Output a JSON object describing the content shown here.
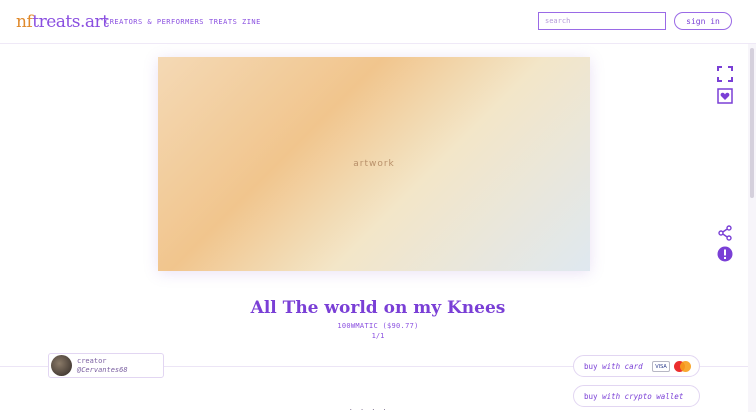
{
  "header": {
    "logo_nf": "nf",
    "logo_rest": "treats.art",
    "nav": [
      "CREATORS & PERFORMERS",
      "TREATS ZINE"
    ],
    "search_placeholder": "search",
    "signin_label": "sign in"
  },
  "artwork": {
    "title": "All The world on my Knees",
    "price": "100WMATIC ($90.77)",
    "edition": "1/1",
    "placeholder_label": "artwork"
  },
  "creator": {
    "label": "creator",
    "handle": "@Cervantes68"
  },
  "purchase": {
    "card_prefix": "buy",
    "card_suffix": "with card",
    "card_brand": "VISA",
    "wallet_prefix": "buy",
    "wallet_suffix": "with crypto wallet"
  },
  "icons": {
    "fullscreen": "fullscreen-icon",
    "favorite": "heart-icon",
    "share": "share-icon",
    "report": "alert-icon"
  },
  "colors": {
    "accent": "#7a3fd6",
    "logo_orange": "#e08a2c"
  },
  "footer": {
    "dots": ". . . ."
  }
}
